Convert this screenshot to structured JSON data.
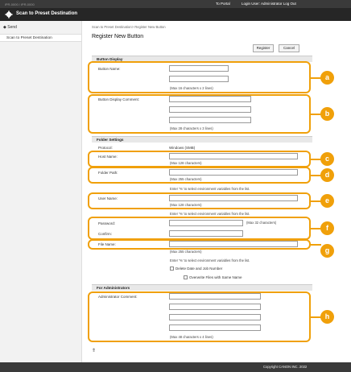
{
  "topbar": {
    "address": "iPR-0000 / iPR-0000",
    "portal": "To Portal",
    "login": "Login User: Administrator Log Out"
  },
  "titlebar": {
    "title": "Scan to Preset Destination"
  },
  "sidebar": {
    "back": "◆ Send",
    "items": [
      {
        "label": "Scan to Preset Destination"
      }
    ]
  },
  "breadcrumb": "Scan to Preset Destination> Register New Button",
  "page_title": "Register New Button",
  "buttons": {
    "register": "Register",
    "cancel": "Cancel"
  },
  "button_display": {
    "header": "Button Display",
    "name_label": "Button Name:",
    "name_note": "(Max 16 characters x 2 lines)",
    "comment_label": "Button Display Comment:",
    "comment_note": "(Max 28 characters x 3 lines)"
  },
  "folder": {
    "header": "Folder Settings",
    "protocol_label": "Protocol:",
    "protocol_value": "Windows (SMB)",
    "host_label": "Host Name:",
    "host_note": "(Max 128 characters)",
    "path_label": "Folder Path:",
    "path_note": "(Max 255 characters)",
    "env_hint": "Enter '%' to select environment variables from the list.",
    "user_label": "User Name:",
    "user_note": "(Max 128 characters)",
    "password_label": "Password:",
    "password_note": "(Max 32 characters)",
    "confirm_label": "Confirm:",
    "file_label": "File Name:",
    "file_note": "(Max 255 characters)",
    "delete_date_label": "Delete Date and Job Number",
    "overwrite_label": "Overwrite Files with Same Name"
  },
  "admin": {
    "header": "For Administrators",
    "comment_label": "Administrator Comment:",
    "comment_note": "(Max 48 characters x 4 lines)"
  },
  "callouts": [
    "a",
    "b",
    "c",
    "d",
    "e",
    "f",
    "g",
    "h"
  ],
  "top_arrow": "⇑",
  "footer": "Copyright CANON INC. 2022",
  "colors": {
    "accent": "#f0a00a",
    "titlebar": "#262626",
    "topbar": "#3a3a3a"
  }
}
